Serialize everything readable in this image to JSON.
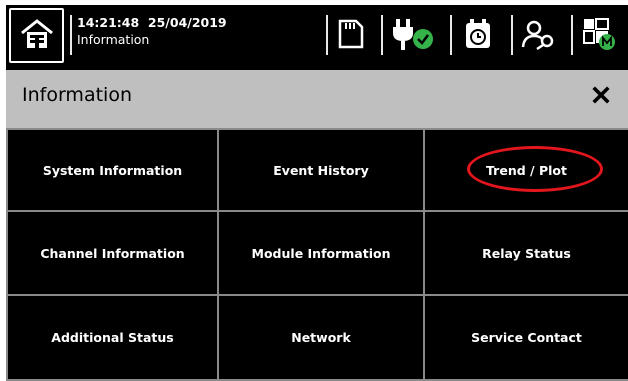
{
  "status_bar": {
    "time": "14:21:48",
    "date": "25/04/2019",
    "screen": "Information"
  },
  "header": {
    "title": "Information",
    "close_label": "✖"
  },
  "menu": {
    "items": [
      {
        "label": "System Information"
      },
      {
        "label": "Event History"
      },
      {
        "label": "Trend / Plot",
        "highlighted": true
      },
      {
        "label": "Channel Information"
      },
      {
        "label": "Module Information"
      },
      {
        "label": "Relay Status"
      },
      {
        "label": "Additional Status"
      },
      {
        "label": "Network"
      },
      {
        "label": "Service Contact"
      }
    ]
  },
  "icons": [
    "home-icon",
    "sd-card-icon",
    "power-plug-ok-icon",
    "alarm-clock-icon",
    "user-key-icon",
    "module-grid-icon"
  ],
  "colors": {
    "background": "#000000",
    "header": "#bfbfbf",
    "highlight": "#e3161e",
    "ok_green": "#35b249"
  }
}
